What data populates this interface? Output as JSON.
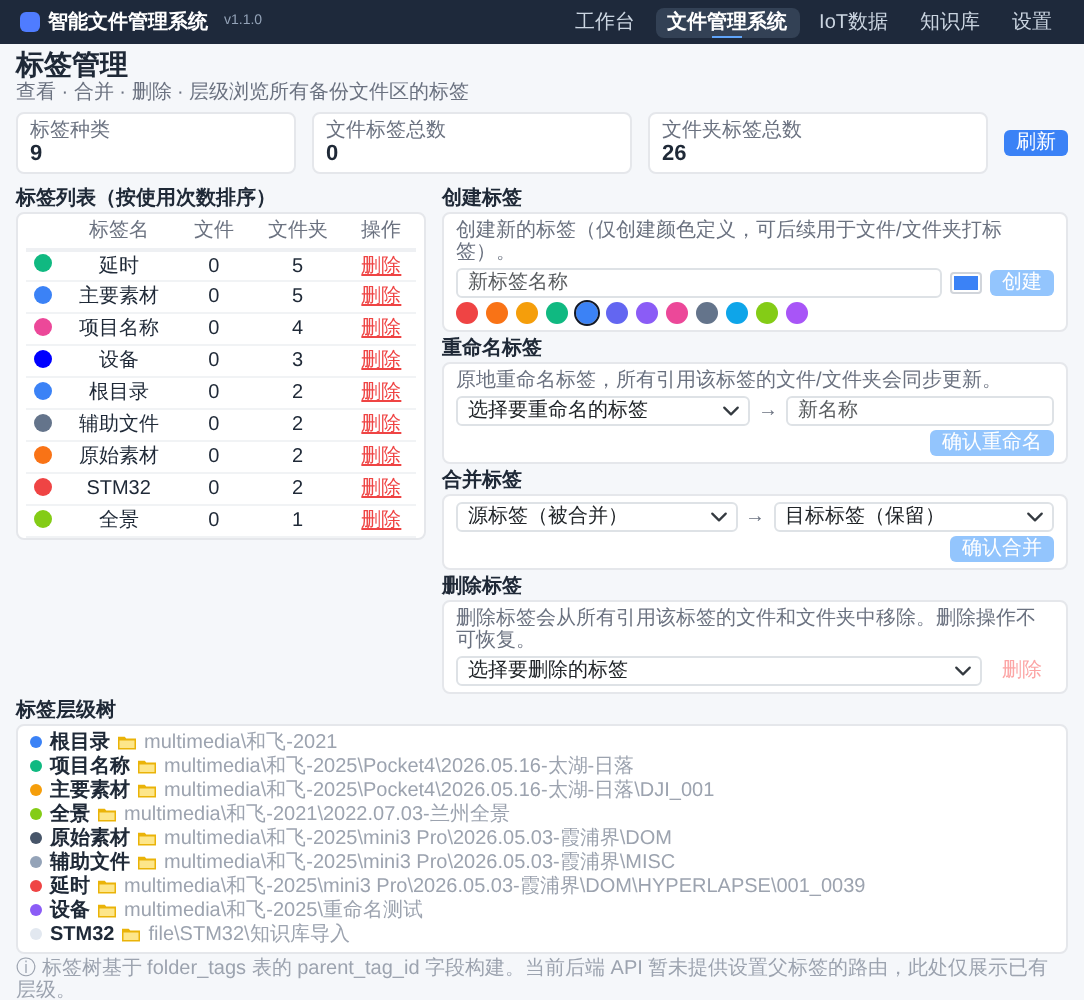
{
  "navbar": {
    "brand": "智能文件管理系统",
    "version": "v1.1.0",
    "links": [
      {
        "label": "工作台",
        "selected": false
      },
      {
        "label": "文件管理系统",
        "selected": true
      },
      {
        "label": "IoT数据",
        "selected": false
      },
      {
        "label": "知识库",
        "selected": false
      },
      {
        "label": "设置",
        "selected": false
      }
    ]
  },
  "page": {
    "title": "标签管理",
    "subtitle": "查看 · 合并 · 删除 · 层级浏览所有备份文件区的标签"
  },
  "stats": [
    {
      "label": "标签种类",
      "value": "9"
    },
    {
      "label": "文件标签总数",
      "value": "0"
    },
    {
      "label": "文件夹标签总数",
      "value": "26"
    }
  ],
  "refresh_button": "刷新",
  "tag_table": {
    "title": "标签列表（按使用次数排序）",
    "columns": [
      "标签名",
      "文件",
      "文件夹",
      "操作"
    ],
    "rows": [
      {
        "color": "#10b981",
        "name": "延时",
        "files": "0",
        "folders": "5",
        "action": "删除"
      },
      {
        "color": "#3b82f6",
        "name": "主要素材",
        "files": "0",
        "folders": "5",
        "action": "删除"
      },
      {
        "color": "#ec4899",
        "name": "项目名称",
        "files": "0",
        "folders": "4",
        "action": "删除"
      },
      {
        "color": "#0000ff",
        "name": "设备",
        "files": "0",
        "folders": "3",
        "action": "删除"
      },
      {
        "color": "#3b82f6",
        "name": "根目录",
        "files": "0",
        "folders": "2",
        "action": "删除"
      },
      {
        "color": "#64748b",
        "name": "辅助文件",
        "files": "0",
        "folders": "2",
        "action": "删除"
      },
      {
        "color": "#f97316",
        "name": "原始素材",
        "files": "0",
        "folders": "2",
        "action": "删除"
      },
      {
        "color": "#ef4444",
        "name": "STM32",
        "files": "0",
        "folders": "2",
        "action": "删除"
      },
      {
        "color": "#84cc16",
        "name": "全景",
        "files": "0",
        "folders": "1",
        "action": "删除"
      }
    ]
  },
  "create": {
    "title": "创建标签",
    "hint": "创建新的标签（仅创建颜色定义，可后续用于文件/文件夹打标签）。",
    "placeholder": "新标签名称",
    "color_input": {
      "color": "#3b82f6"
    },
    "button": {
      "label": "创建",
      "disabled": true
    },
    "palette": [
      {
        "color": "#ef4444",
        "selected": false
      },
      {
        "color": "#f97316",
        "selected": false
      },
      {
        "color": "#f59e0b",
        "selected": false
      },
      {
        "color": "#10b981",
        "selected": false
      },
      {
        "color": "#3b82f6",
        "selected": true
      },
      {
        "color": "#6366f1",
        "selected": false
      },
      {
        "color": "#8b5cf6",
        "selected": false
      },
      {
        "color": "#ec4899",
        "selected": false
      },
      {
        "color": "#64748b",
        "selected": false
      },
      {
        "color": "#0ea5e9",
        "selected": false
      },
      {
        "color": "#84cc16",
        "selected": false
      },
      {
        "color": "#a855f7",
        "selected": false
      }
    ]
  },
  "rename": {
    "title": "重命名标签",
    "hint": "原地重命名标签，所有引用该标签的文件/文件夹会同步更新。",
    "select": "选择要重命名的标签",
    "arrow": "→",
    "placeholder": "新名称",
    "button": {
      "label": "确认重命名",
      "disabled": true
    }
  },
  "merge": {
    "title": "合并标签",
    "source": "源标签（被合并）",
    "arrow": "→",
    "target": "目标标签（保留）",
    "button": {
      "label": "确认合并",
      "disabled": true
    }
  },
  "delete": {
    "title": "删除标签",
    "hint": "删除标签会从所有引用该标签的文件和文件夹中移除。删除操作不可恢复。",
    "select": "选择要删除的标签",
    "button": {
      "label": "删除",
      "disabled": true
    }
  },
  "tree": {
    "title": "标签层级树",
    "nodes": [
      {
        "color": "#3b82f6",
        "name": "根目录",
        "path": "multimedia\\和飞-2021"
      },
      {
        "color": "#10b981",
        "name": "项目名称",
        "path": "multimedia\\和飞-2025\\Pocket4\\2026.05.16-太湖-日落"
      },
      {
        "color": "#f59e0b",
        "name": "主要素材",
        "path": "multimedia\\和飞-2025\\Pocket4\\2026.05.16-太湖-日落\\DJI_001"
      },
      {
        "color": "#84cc16",
        "name": "全景",
        "path": "multimedia\\和飞-2021\\2022.07.03-兰州全景"
      },
      {
        "color": "#475569",
        "name": "原始素材",
        "path": "multimedia\\和飞-2025\\mini3 Pro\\2026.05.03-霞浦界\\DOM"
      },
      {
        "color": "#94a3b8",
        "name": "辅助文件",
        "path": "multimedia\\和飞-2025\\mini3 Pro\\2026.05.03-霞浦界\\MISC"
      },
      {
        "color": "#ef4444",
        "name": "延时",
        "path": "multimedia\\和飞-2025\\mini3 Pro\\2026.05.03-霞浦界\\DOM\\HYPERLAPSE\\001_0039"
      },
      {
        "color": "#8b5cf6",
        "name": "设备",
        "path": "multimedia\\和飞-2025\\重命名测试"
      },
      {
        "color": "#e2e8f0",
        "name": "STM32",
        "path": "file\\STM32\\知识库导入"
      }
    ],
    "note": "ⓘ 标签树基于 folder_tags 表的 parent_tag_id 字段构建。当前后端 API 暂未提供设置父标签的路由，此处仅展示已有层级。"
  }
}
